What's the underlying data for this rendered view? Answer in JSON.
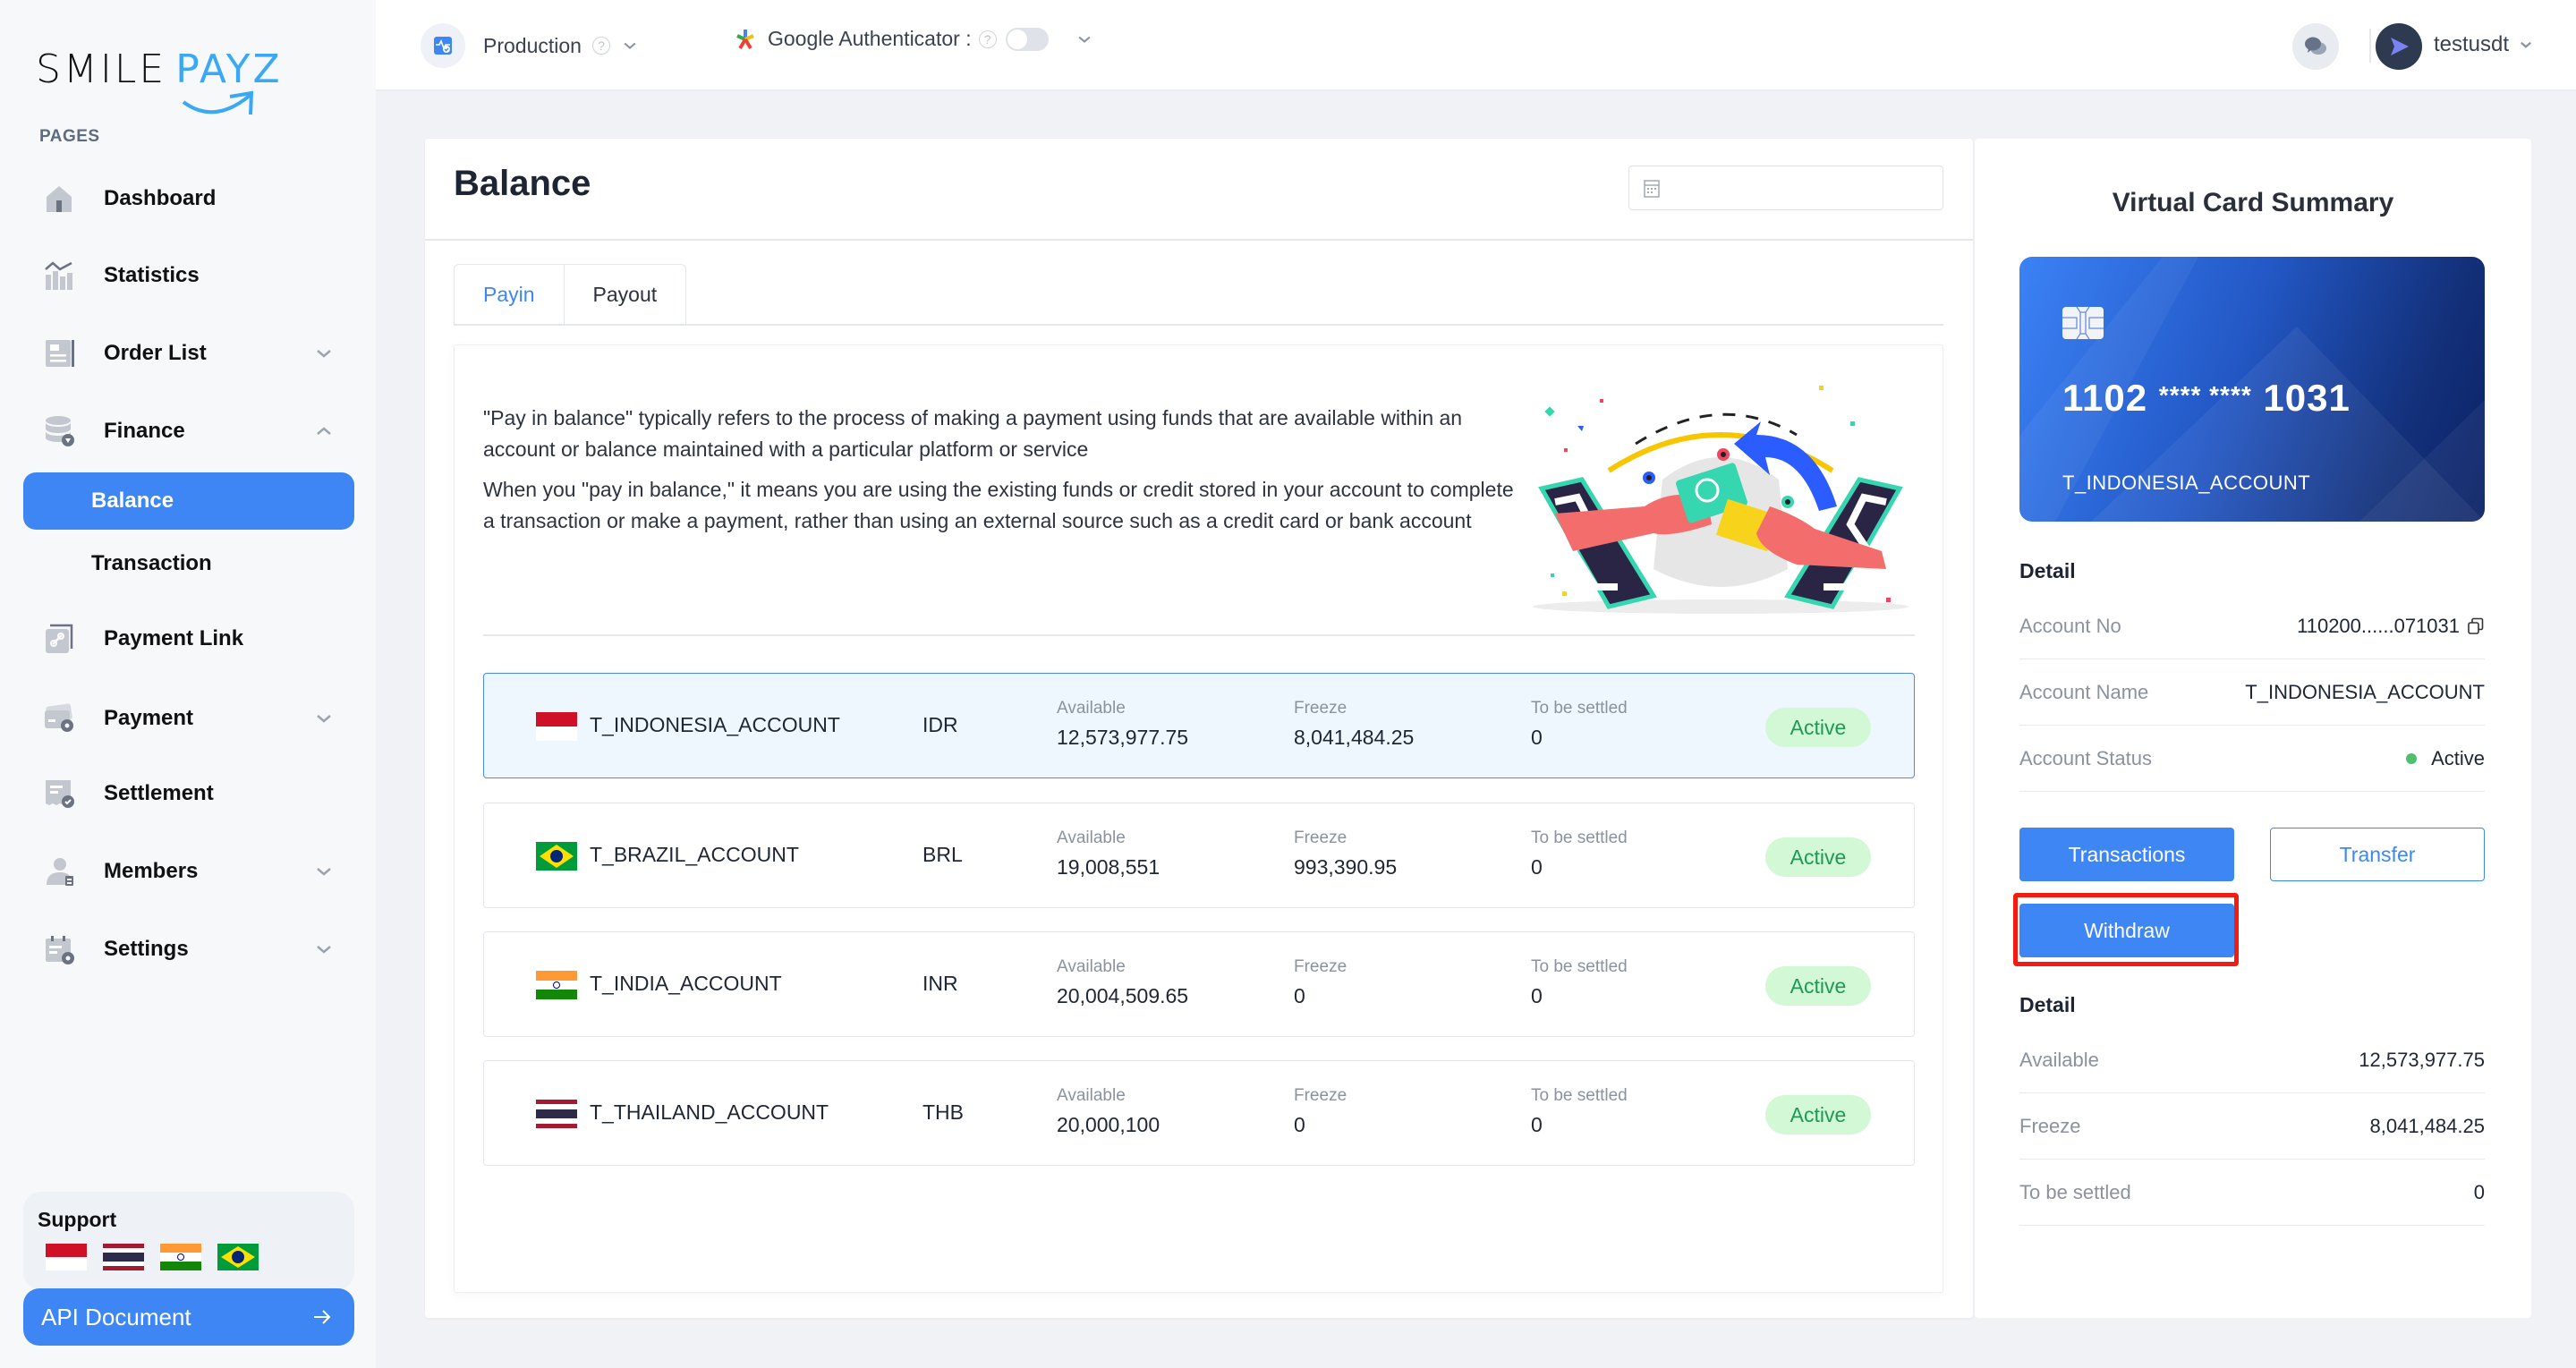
{
  "brand": {
    "name_part1": "SMILE",
    "name_part2": "PAYZ",
    "accent": "#3aa9f5"
  },
  "sidebar": {
    "section_label": "PAGES",
    "items": [
      {
        "label": "Dashboard",
        "icon": "home-icon",
        "has_chevron": false
      },
      {
        "label": "Statistics",
        "icon": "chart-icon",
        "has_chevron": false
      },
      {
        "label": "Order List",
        "icon": "list-icon",
        "has_chevron": true,
        "expanded": false
      },
      {
        "label": "Finance",
        "icon": "database-icon",
        "has_chevron": true,
        "expanded": true
      },
      {
        "label": "Balance",
        "icon": null,
        "sub": true,
        "active": true
      },
      {
        "label": "Transaction",
        "icon": null,
        "sub": true
      },
      {
        "label": "Payment Link",
        "icon": "link-icon",
        "has_chevron": false
      },
      {
        "label": "Payment",
        "icon": "card-gear-icon",
        "has_chevron": true,
        "expanded": false
      },
      {
        "label": "Settlement",
        "icon": "receipt-check-icon",
        "has_chevron": false
      },
      {
        "label": "Members",
        "icon": "user-icon",
        "has_chevron": true,
        "expanded": false
      },
      {
        "label": "Settings",
        "icon": "calendar-gear-icon",
        "has_chevron": true,
        "expanded": false
      }
    ],
    "support": {
      "title": "Support",
      "flags": [
        "Indonesia",
        "Thailand",
        "India",
        "Brazil"
      ]
    },
    "api_document": {
      "label": "API Document",
      "icon": "arrow-right-icon"
    }
  },
  "header": {
    "environment": {
      "label": "Production",
      "help": "?"
    },
    "google_auth": {
      "label": "Google Authenticator :",
      "help": "?",
      "enabled": false
    },
    "user": {
      "name": "testusdt"
    }
  },
  "main": {
    "title": "Balance",
    "date_input": {
      "value": "",
      "placeholder": ""
    },
    "tabs": [
      {
        "label": "Payin",
        "active": true
      },
      {
        "label": "Payout",
        "active": false
      }
    ],
    "description": [
      "\"Pay in balance\" typically refers to the process of making a payment using funds that are available within an account or balance maintained with a particular platform or service",
      "When you \"pay in balance,\" it means you are using the existing funds or credit stored in your account to complete a transaction or make a payment, rather than using an external source such as a credit card or bank account"
    ],
    "column_labels": {
      "available": "Available",
      "freeze": "Freeze",
      "to_be_settled": "To be settled"
    },
    "accounts": [
      {
        "name": "T_INDONESIA_ACCOUNT",
        "currency": "IDR",
        "country": "Indonesia",
        "available": "12,573,977.75",
        "freeze": "8,041,484.25",
        "to_be_settled": "0",
        "status": "Active",
        "selected": true
      },
      {
        "name": "T_BRAZIL_ACCOUNT",
        "currency": "BRL",
        "country": "Brazil",
        "available": "19,008,551",
        "freeze": "993,390.95",
        "to_be_settled": "0",
        "status": "Active",
        "selected": false
      },
      {
        "name": "T_INDIA_ACCOUNT",
        "currency": "INR",
        "country": "India",
        "available": "20,004,509.65",
        "freeze": "0",
        "to_be_settled": "0",
        "status": "Active",
        "selected": false
      },
      {
        "name": "T_THAILAND_ACCOUNT",
        "currency": "THB",
        "country": "Thailand",
        "available": "20,000,100",
        "freeze": "0",
        "to_be_settled": "0",
        "status": "Active",
        "selected": false
      }
    ]
  },
  "card_summary": {
    "title": "Virtual Card Summary",
    "card": {
      "num_start": "1102",
      "num_mask": "**** ****",
      "num_end": "1031",
      "holder": "T_INDONESIA_ACCOUNT"
    },
    "detail_title": "Detail",
    "details": [
      {
        "label": "Account No",
        "value": "110200......071031",
        "copy": true
      },
      {
        "label": "Account Name",
        "value": "T_INDONESIA_ACCOUNT"
      },
      {
        "label": "Account Status",
        "value": "Active",
        "status_color": "#4fbf6d"
      }
    ],
    "buttons": {
      "transactions": "Transactions",
      "transfer": "Transfer",
      "withdraw": "Withdraw"
    },
    "balance_title": "Detail",
    "balances": [
      {
        "label": "Available",
        "value": "12,573,977.75"
      },
      {
        "label": "Freeze",
        "value": "8,041,484.25"
      },
      {
        "label": "To be settled",
        "value": "0"
      }
    ]
  }
}
